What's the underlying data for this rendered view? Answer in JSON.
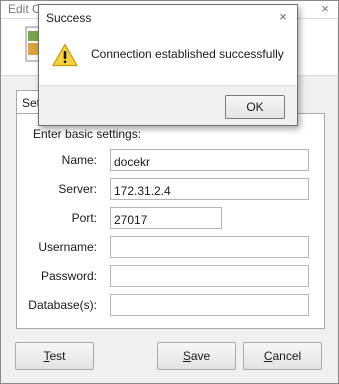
{
  "window": {
    "title": "Edit Connection",
    "close_glyph": "×"
  },
  "tab": {
    "label": "Settings"
  },
  "form": {
    "section_label": "Enter basic settings:",
    "name_label": "Name:",
    "name_value": "docekr",
    "server_label": "Server:",
    "server_value": "172.31.2.4",
    "port_label": "Port:",
    "port_value": "27017",
    "username_label": "Username:",
    "username_value": "",
    "password_label": "Password:",
    "password_value": "",
    "database_label": "Database(s):",
    "database_value": ""
  },
  "buttons": {
    "test_first": "T",
    "test_rest": "est",
    "save_first": "S",
    "save_rest": "ave",
    "cancel_first": "C",
    "cancel_rest": "ancel"
  },
  "dialog": {
    "title": "Success",
    "close_glyph": "×",
    "message": "Connection established successfully",
    "ok_label": "OK",
    "icon": "warning-icon"
  },
  "colors": {
    "warning_fill": "#f7d23e",
    "warning_stroke": "#c79a00",
    "window_bg": "#f0f0f0"
  }
}
